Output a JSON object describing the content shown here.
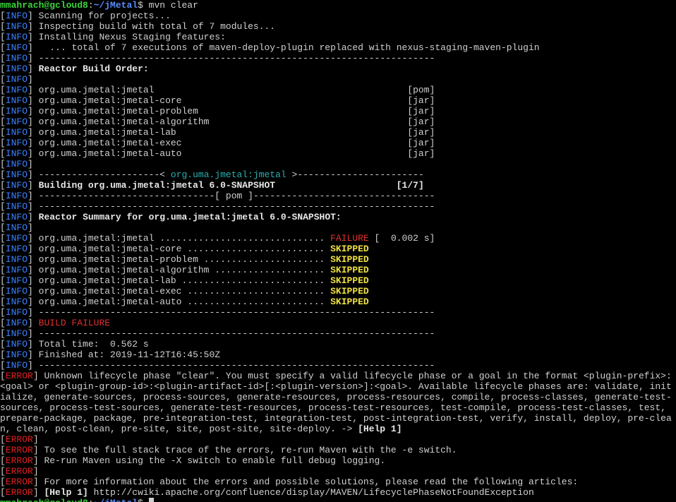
{
  "window": {
    "prompt": {
      "user_host": "mmahrach@gcloud8",
      "separator": ":",
      "path": "~/jMetal",
      "symbol": "$ ",
      "command": "mvn clear"
    }
  },
  "levels": {
    "info": "INFO",
    "error": "ERROR",
    "open": "[",
    "close": "]"
  },
  "output": {
    "scanning": " Scanning for projects...",
    "inspecting": " Inspecting build with total of 7 modules...",
    "nexus": " Installing Nexus Staging features:",
    "replaced": "   ... total of 7 executions of maven-deploy-plugin replaced with nexus-staging-maven-plugin",
    "rule": " ------------------------------------------------------------------------",
    "reactor_build_order": "Reactor Build Order:",
    "build_order": [
      " org.uma.jmetal:jmetal                                              [pom]",
      " org.uma.jmetal:jmetal-core                                         [jar]",
      " org.uma.jmetal:jmetal-problem                                      [jar]",
      " org.uma.jmetal:jmetal-algorithm                                    [jar]",
      " org.uma.jmetal:jmetal-lab                                          [jar]",
      " org.uma.jmetal:jmetal-exec                                         [jar]",
      " org.uma.jmetal:jmetal-auto                                         [jar]"
    ],
    "module_rule_left": " ----------------------< ",
    "module_name": "org.uma.jmetal:jmetal",
    "module_rule_right": " >-----------------------",
    "building": "Building org.uma.jmetal:jmetal 6.0-SNAPSHOT                      [1/7]",
    "pom_rule": " --------------------------------[ pom ]---------------------------------",
    "summary_title": "Reactor Summary for org.uma.jmetal:jmetal 6.0-SNAPSHOT:",
    "summary": [
      {
        "label": " org.uma.jmetal:jmetal .............................. ",
        "status": "FAILURE",
        "extra": " [  0.002 s]"
      },
      {
        "label": " org.uma.jmetal:jmetal-core ......................... ",
        "status": "SKIPPED",
        "extra": ""
      },
      {
        "label": " org.uma.jmetal:jmetal-problem ...................... ",
        "status": "SKIPPED",
        "extra": ""
      },
      {
        "label": " org.uma.jmetal:jmetal-algorithm .................... ",
        "status": "SKIPPED",
        "extra": ""
      },
      {
        "label": " org.uma.jmetal:jmetal-lab .......................... ",
        "status": "SKIPPED",
        "extra": ""
      },
      {
        "label": " org.uma.jmetal:jmetal-exec ......................... ",
        "status": "SKIPPED",
        "extra": ""
      },
      {
        "label": " org.uma.jmetal:jmetal-auto ......................... ",
        "status": "SKIPPED",
        "extra": ""
      }
    ],
    "build_failure": "BUILD FAILURE",
    "total_time": " Total time:  0.562 s",
    "finished_at": " Finished at: 2019-11-12T16:45:50Z"
  },
  "errors": {
    "unknown_phase_lines": [
      " Unknown lifecycle phase \"clear\". You must specify a valid lifecycle phase or a goal in the format <plugin-prefix>:",
      "<goal> or <plugin-group-id>:<plugin-artifact-id>[:<plugin-version>]:<goal>. Available lifecycle phases are: validate, init",
      "ialize, generate-sources, process-sources, generate-resources, process-resources, compile, process-classes, generate-test-",
      "sources, process-test-sources, generate-test-resources, process-test-resources, test-compile, process-test-classes, test,",
      "prepare-package, package, pre-integration-test, integration-test, post-integration-test, verify, install, deploy, pre-clea"
    ],
    "last_line_text": "n, clean, post-clean, pre-site, site, post-site, site-deploy. -> ",
    "help_ref": "[Help 1]",
    "stack_trace": " To see the full stack trace of the errors, re-run Maven with the -e switch.",
    "debug": " Re-run Maven using the -X switch to enable full debug logging.",
    "more_info": " For more information about the errors and possible solutions, please read the following articles:",
    "help1_label": "[Help 1]",
    "help1_url": " http://cwiki.apache.org/confluence/display/MAVEN/LifecyclePhaseNotFoundException"
  },
  "colors": {
    "background": "#000000",
    "info": "#3c82ff",
    "error": "#e02020",
    "skipped": "#f0e040",
    "prompt_user": "#3cd23c",
    "prompt_path": "#5a8cff"
  }
}
